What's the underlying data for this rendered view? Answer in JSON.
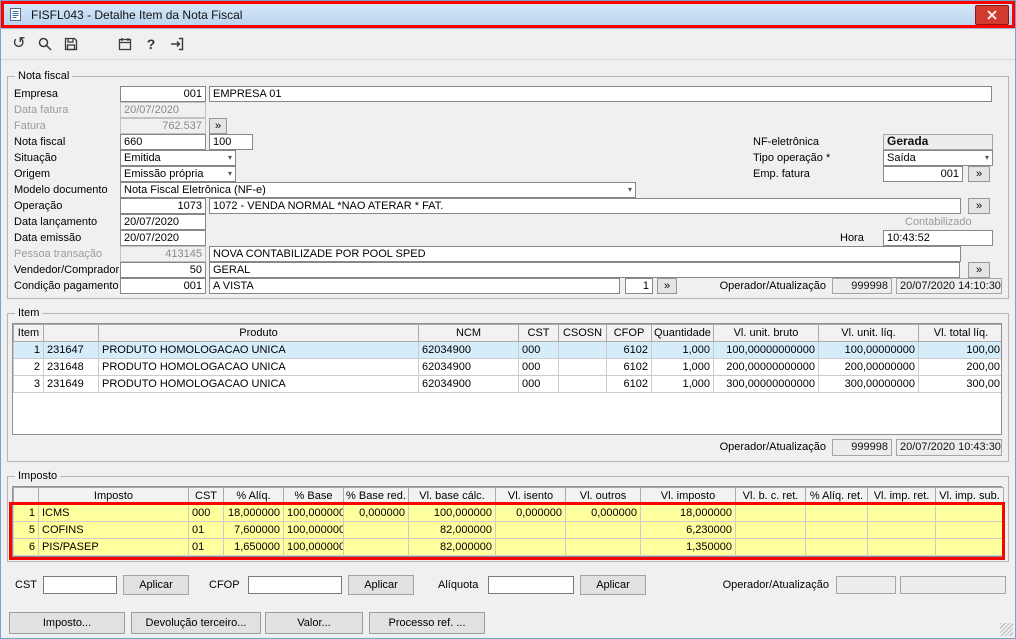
{
  "colors": {
    "annotation": "#ff0000",
    "tax-row": "#ffff9e",
    "selected-row": "#d5edfb",
    "titlebar": "#bcd7f1"
  },
  "glyphs": {
    "lookup": "»",
    "dropdown": "▾",
    "undo": "↺",
    "help": "?"
  },
  "window": {
    "title": "FISFL043 - Detalhe Item da Nota Fiscal"
  },
  "toolbar": {
    "icons": [
      "undo",
      "search",
      "save",
      "calendar",
      "help",
      "exit"
    ]
  },
  "nota_fiscal": {
    "legend": "Nota fiscal",
    "empresa": {
      "label": "Empresa",
      "code": "001",
      "name": "EMPRESA 01"
    },
    "data_fatura": {
      "label": "Data fatura",
      "value": "20/07/2020"
    },
    "fatura": {
      "label": "Fatura",
      "value": "762.537"
    },
    "nota": {
      "label": "Nota fiscal",
      "numero": "660",
      "serie": "100"
    },
    "situacao": {
      "label": "Situação",
      "value": "Emitida"
    },
    "origem": {
      "label": "Origem",
      "value": "Emissão própria"
    },
    "modelo": {
      "label": "Modelo documento",
      "value": "Nota Fiscal Eletrônica (NF-e)"
    },
    "operacao": {
      "label": "Operação",
      "code": "1073",
      "descricao": "1072 - VENDA NORMAL  *NAO ATERAR * FAT."
    },
    "data_lancamento": {
      "label": "Data lançamento",
      "value": "20/07/2020"
    },
    "data_emissao": {
      "label": "Data emissão",
      "value": "20/07/2020"
    },
    "pessoa": {
      "label": "Pessoa transação",
      "code": "413145",
      "name": "NOVA CONTABILIZADE POR POOL SPED"
    },
    "vendedor": {
      "label": "Vendedor/Comprador",
      "code": "50",
      "name": "GERAL"
    },
    "condicao": {
      "label": "Condição pagamento",
      "code": "001",
      "name": "A VISTA",
      "parcela": "1"
    },
    "nf_eletronica": {
      "label": "NF-eletrônica",
      "value": "Gerada"
    },
    "tipo_operacao": {
      "label": "Tipo operação *",
      "value": "Saída"
    },
    "emp_fatura": {
      "label": "Emp. fatura",
      "value": "001"
    },
    "contabilizado_label": "Contabilizado",
    "hora": {
      "label": "Hora",
      "value": "10:43:52"
    },
    "operador": {
      "label": "Operador/Atualização",
      "code": "999998",
      "datetime": "20/07/2020 14:10:30"
    }
  },
  "item": {
    "legend": "Item",
    "table": {
      "columns": [
        "Item",
        "",
        "Produto",
        "NCM",
        "CST",
        "CSOSN",
        "CFOP",
        "Quantidade",
        "Vl. unit. bruto",
        "Vl. unit. líq.",
        "Vl. total líq."
      ],
      "rows": [
        [
          "1",
          "231647",
          "PRODUTO HOMOLOGACAO UNICA",
          "62034900",
          "000",
          "",
          "6102",
          "1,000",
          "100,00000000000",
          "100,00000000",
          "100,00"
        ],
        [
          "2",
          "231648",
          "PRODUTO HOMOLOGACAO UNICA",
          "62034900",
          "000",
          "",
          "6102",
          "1,000",
          "200,00000000000",
          "200,00000000",
          "200,00"
        ],
        [
          "3",
          "231649",
          "PRODUTO HOMOLOGACAO UNICA",
          "62034900",
          "000",
          "",
          "6102",
          "1,000",
          "300,00000000000",
          "300,00000000",
          "300,00"
        ]
      ],
      "selected_row": 0
    },
    "operador": {
      "label": "Operador/Atualização",
      "code": "999998",
      "datetime": "20/07/2020 10:43:30"
    }
  },
  "imposto": {
    "legend": "Imposto",
    "table": {
      "columns": [
        "",
        "Imposto",
        "CST",
        "% Alíq.",
        "% Base",
        "% Base red.",
        "Vl. base cálc.",
        "Vl. isento",
        "Vl. outros",
        "Vl. imposto",
        "Vl. b. c. ret.",
        "% Alíq. ret.",
        "Vl. imp. ret.",
        "Vl. imp. sub."
      ],
      "rows": [
        [
          "1",
          "ICMS",
          "000",
          "18,000000",
          "100,000000",
          "0,000000",
          "100,000000",
          "0,000000",
          "0,000000",
          "18,000000",
          "",
          "",
          "",
          ""
        ],
        [
          "5",
          "COFINS",
          "01",
          "7,600000",
          "100,000000",
          "",
          "82,000000",
          "",
          "",
          "6,230000",
          "",
          "",
          "",
          ""
        ],
        [
          "6",
          "PIS/PASEP",
          "01",
          "1,650000",
          "100,000000",
          "",
          "82,000000",
          "",
          "",
          "1,350000",
          "",
          "",
          "",
          ""
        ]
      ]
    },
    "cst": {
      "label": "CST",
      "value": "",
      "apply": "Aplicar"
    },
    "cfop": {
      "label": "CFOP",
      "value": "",
      "apply": "Aplicar"
    },
    "aliquota": {
      "label": "Alíquota",
      "value": "",
      "apply": "Aplicar"
    },
    "operador": {
      "label": "Operador/Atualização",
      "code": "",
      "datetime": ""
    }
  },
  "footer": {
    "buttons": [
      "Imposto...",
      "Devolução terceiro...",
      "Valor...",
      "Processo ref. ..."
    ]
  }
}
